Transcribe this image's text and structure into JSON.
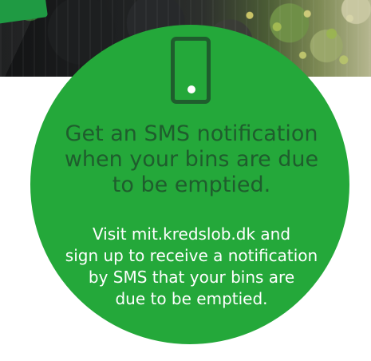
{
  "colors": {
    "circle": "#24a83a",
    "headline": "#1f5d2d",
    "body_text": "#ffffff",
    "icon": "#1f5d2d"
  },
  "icon": {
    "name": "mobile-phone-icon"
  },
  "headline_lines": [
    "Get an SMS notification",
    "when your bins are due",
    "to be emptied."
  ],
  "body_lines": [
    "Visit mit.kredslob.dk and",
    "sign up to receive a notification",
    "by SMS that your bins are",
    "due to be emptied."
  ]
}
